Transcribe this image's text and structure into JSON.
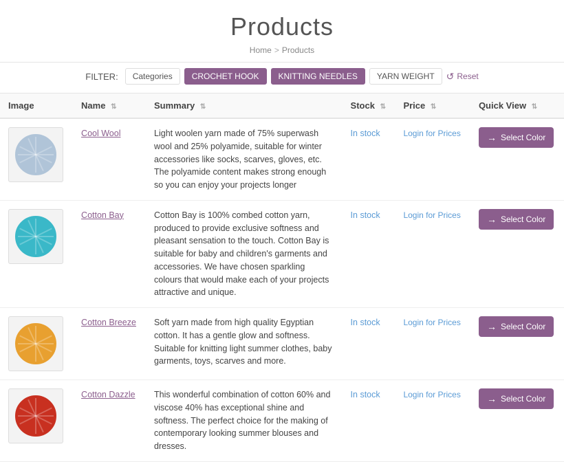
{
  "page": {
    "title": "Products",
    "breadcrumb": {
      "home": "Home",
      "separator": ">",
      "current": "Products"
    }
  },
  "filter": {
    "label": "FILTER:",
    "buttons": [
      {
        "id": "categories",
        "label": "Categories",
        "active": false
      },
      {
        "id": "crochet-hook",
        "label": "CROCHET HOOK",
        "active": true
      },
      {
        "id": "knitting-needles",
        "label": "KNITTING NEEDLES",
        "active": true
      },
      {
        "id": "yarn-weight",
        "label": "YARN WEIGHT",
        "active": false
      }
    ],
    "reset_label": "Reset"
  },
  "table": {
    "columns": [
      {
        "id": "image",
        "label": "Image"
      },
      {
        "id": "name",
        "label": "Name"
      },
      {
        "id": "summary",
        "label": "Summary"
      },
      {
        "id": "stock",
        "label": "Stock"
      },
      {
        "id": "price",
        "label": "Price"
      },
      {
        "id": "quickview",
        "label": "Quick View"
      }
    ],
    "rows": [
      {
        "id": "cool-wool",
        "name": "Cool Wool",
        "summary": "Light woolen yarn made of 75% superwash wool and 25% polyamide, suitable for winter accessories like socks, scarves, gloves, etc. The polyamide content makes strong enough so you can enjoy your projects longer",
        "stock": "In stock",
        "price": "Login for Prices",
        "btn_label": "Select Color",
        "yarn_color": "#b0c4d8"
      },
      {
        "id": "cotton-bay",
        "name": "Cotton Bay",
        "summary": "Cotton Bay is 100% combed cotton yarn, produced to provide exclusive softness and pleasant sensation to the touch. Cotton Bay is suitable for baby and children's garments and accessories. We have chosen sparkling colours that would make each of your projects attractive and unique.",
        "stock": "In stock",
        "price": "Login for Prices",
        "btn_label": "Select Color",
        "yarn_color": "#3ab8c8"
      },
      {
        "id": "cotton-breeze",
        "name": "Cotton Breeze",
        "summary": "Soft yarn made from high quality Egyptian cotton. It has a gentle glow and softness. Suitable for knitting light summer clothes, baby garments, toys, scarves and more.",
        "stock": "In stock",
        "price": "Login for Prices",
        "btn_label": "Select Color",
        "yarn_color": "#e8a030"
      },
      {
        "id": "cotton-dazzle",
        "name": "Cotton Dazzle",
        "summary": "This wonderful combination of cotton 60% and viscose 40% has exceptional shine and softness. The perfect choice for the making of contemporary looking summer blouses and dresses.",
        "stock": "In stock",
        "price": "Login for Prices",
        "btn_label": "Select Color",
        "yarn_color": "#c83020"
      }
    ]
  }
}
